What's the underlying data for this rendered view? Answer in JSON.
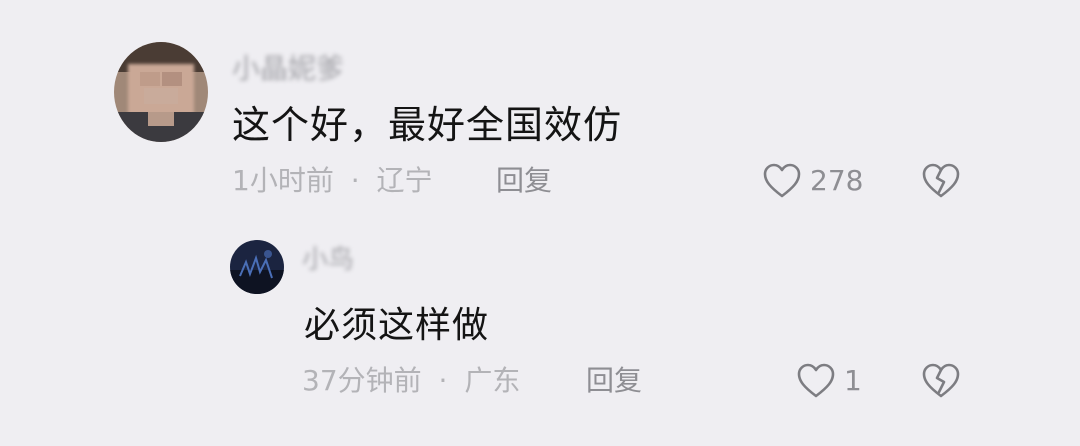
{
  "comments": [
    {
      "username": "小晶妮爹",
      "text": "这个好，最好全国效仿",
      "time": "1小时前",
      "location": "辽宁",
      "separator": "·",
      "reply_label": "回复",
      "like_count": "278"
    }
  ],
  "replies": [
    {
      "username": "小鸟",
      "text": "必须这样做",
      "time": "37分钟前",
      "location": "广东",
      "separator": "·",
      "reply_label": "回复",
      "like_count": "1"
    }
  ],
  "icons": {
    "like": "heart-outline-icon",
    "dislike": "broken-heart-icon"
  },
  "colors": {
    "background": "#efeef2",
    "text": "#141414",
    "meta": "#b3b3b7",
    "action": "#8e8e93"
  }
}
